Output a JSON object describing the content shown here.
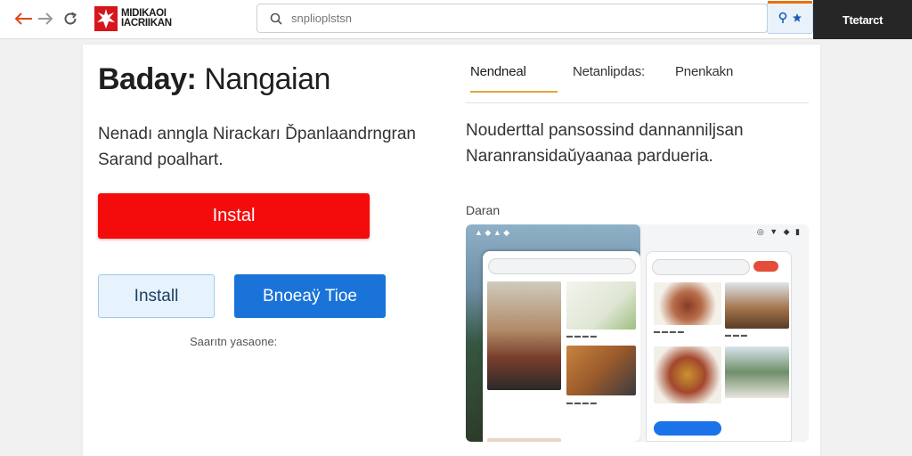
{
  "browser": {
    "address_placeholder": "snplioplstsn",
    "account_label": "Ttetarct"
  },
  "brand": {
    "line1": "MIDIKAOI",
    "line2": "IACRIIKAN"
  },
  "app": {
    "title_part1": "Baday:",
    "title_part2": "Nangaian",
    "description": "Nenadı anngla Nirackarı Ďpanlaandrngran Sarand poalhart.",
    "install_primary": "Instal",
    "install_secondary": "Install",
    "blue_button": "Bnoeaӱ Tioe",
    "caption": "Saarıtn yasaone:"
  },
  "tabs": [
    {
      "label": "Nendneal"
    },
    {
      "label": "Netanlipdas:"
    },
    {
      "label": "Pnenkakn"
    }
  ],
  "details": {
    "description": "Nouderttal pansossind dannanniljsan Naranransidaŭyaanaa pardueria.",
    "screenshots_label": "Daran"
  },
  "colors": {
    "accent_red": "#f40c0c",
    "accent_blue": "#1a73d9",
    "tab_underline": "#e0a53c"
  },
  "icons": [
    "back-arrow-icon",
    "forward-arrow-icon",
    "reload-icon",
    "search-icon",
    "extension-icon",
    "star-icon",
    "lightning-icon"
  ]
}
